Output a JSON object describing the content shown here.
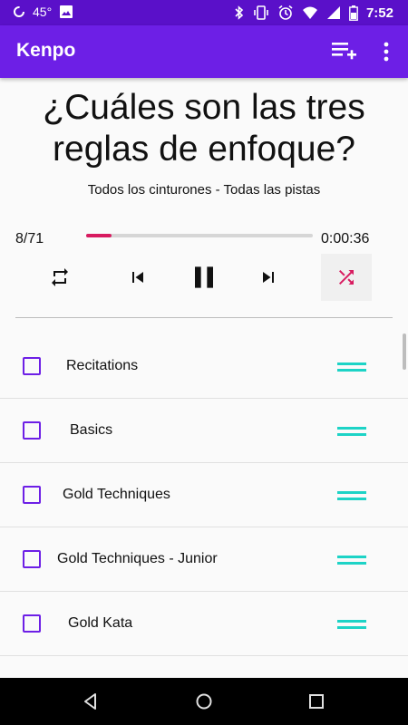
{
  "status_bar": {
    "temperature": "45°",
    "time": "7:52",
    "icons": [
      "data-saver-icon",
      "image-icon",
      "bluetooth-icon",
      "vibrate-icon",
      "alarm-icon",
      "wifi-icon",
      "signal-icon",
      "battery-icon"
    ]
  },
  "app_bar": {
    "title": "Kenpo",
    "icons": [
      "playlist-add-icon",
      "more-vert-icon"
    ]
  },
  "player": {
    "question": "¿Cuáles son las tres reglas de enfoque?",
    "subtitle": "Todos los cinturones - Todas las pistas",
    "counter": "8/71",
    "elapsed": "0:00:36",
    "progress_fraction": 0.11,
    "controls": [
      "repeat-icon",
      "skip-previous-icon",
      "pause-icon",
      "skip-next-icon",
      "shuffle-icon"
    ],
    "accent_color": "#d81b60"
  },
  "list": {
    "items": [
      {
        "label": "Recitations"
      },
      {
        "label": "Basics"
      },
      {
        "label": "Gold Techniques"
      },
      {
        "label": "Gold Techniques - Junior"
      },
      {
        "label": "Gold Kata"
      }
    ]
  },
  "colors": {
    "status_bar": "#5a10c9",
    "app_bar": "#6d1fe6",
    "checkbox": "#6d1fe6",
    "drag_handle": "#1dd3c6"
  },
  "nav_bar": {
    "icons": [
      "back-icon",
      "home-icon",
      "recents-icon"
    ]
  }
}
